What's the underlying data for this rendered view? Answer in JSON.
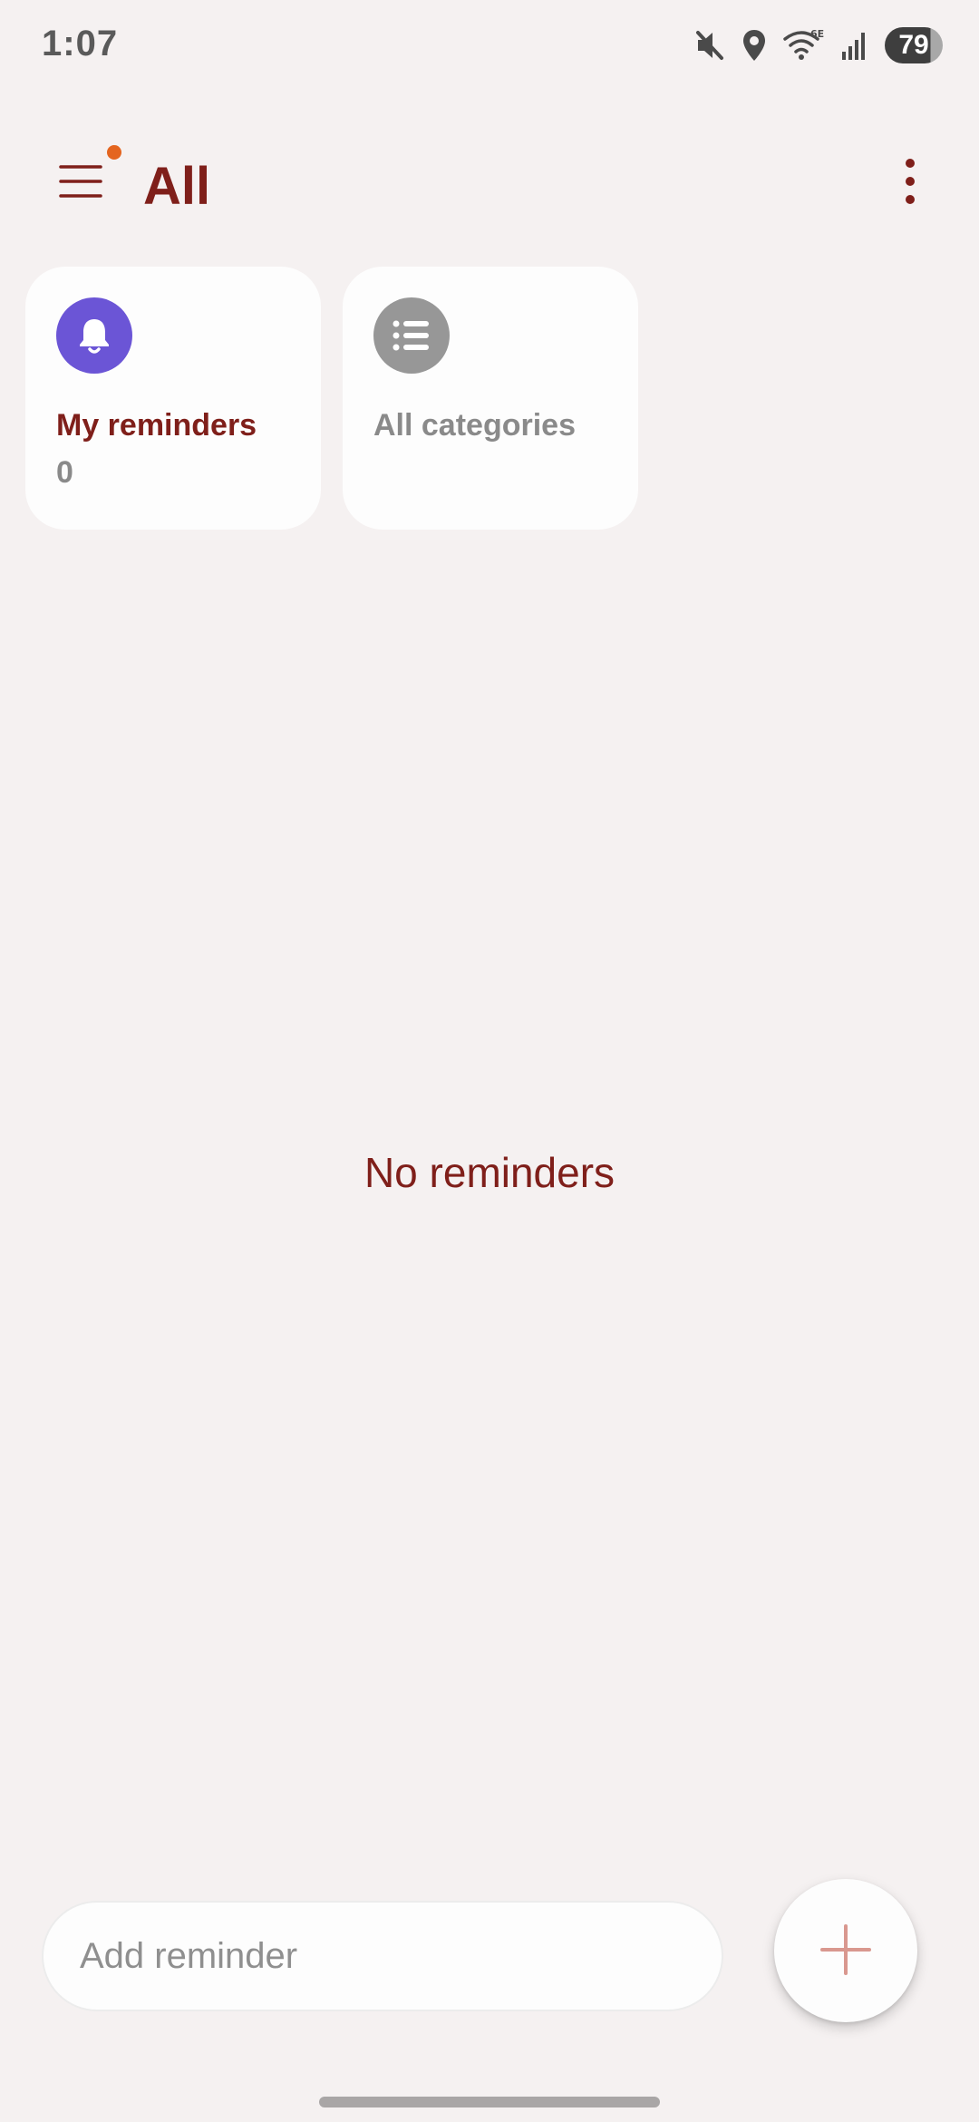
{
  "status_bar": {
    "time": "1:07",
    "battery": "79",
    "icons": [
      "mute-icon",
      "location-icon",
      "wifi-6e-icon",
      "signal-icon"
    ]
  },
  "app_bar": {
    "title": "All",
    "menu_icon": "hamburger-menu-icon",
    "more_icon": "more-vertical-icon",
    "notification_dot_color": "#e4651f"
  },
  "cards": {
    "my_reminders": {
      "label": "My reminders",
      "count": "0",
      "icon": "bell-icon",
      "icon_color": "#6b55d6"
    },
    "all_categories": {
      "label": "All categories",
      "icon": "list-icon",
      "icon_color": "#979797"
    }
  },
  "empty_state": {
    "text": "No reminders"
  },
  "add_reminder": {
    "placeholder": "Add reminder",
    "value": "",
    "fab_icon": "plus-icon"
  },
  "colors": {
    "background": "#f5f1f1",
    "accent": "#7f1f1a",
    "fab_plus": "#d9988f"
  }
}
